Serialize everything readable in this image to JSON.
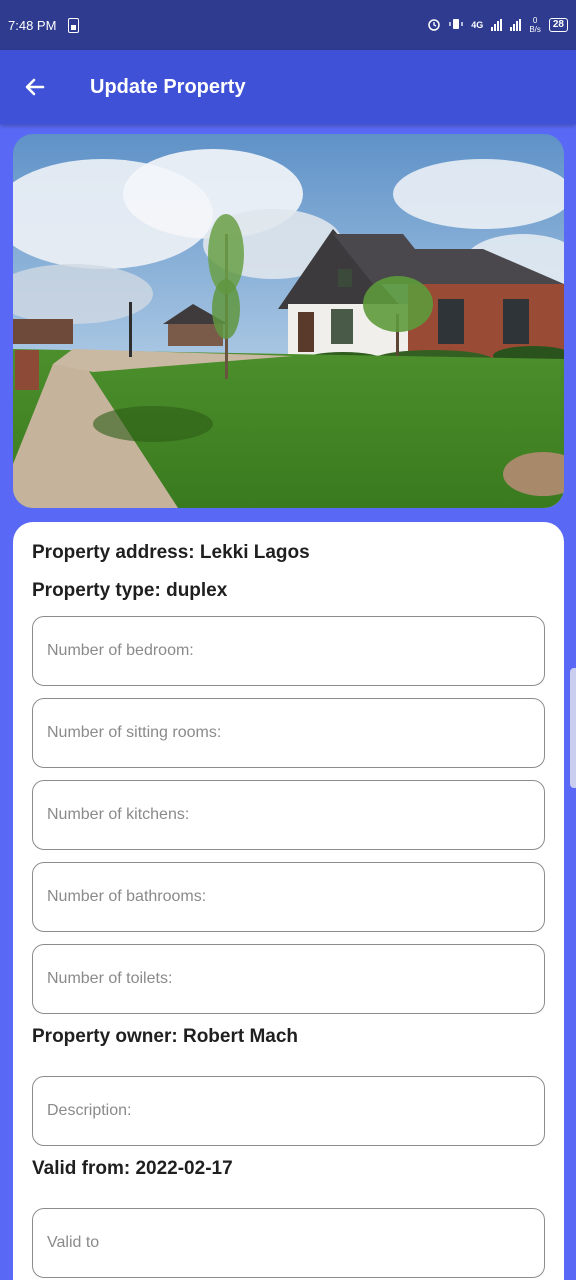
{
  "status_bar": {
    "time": "7:48 PM",
    "network": "4G",
    "speed_value": "0",
    "speed_unit": "B/s",
    "battery": "28"
  },
  "app_bar": {
    "title": "Update Property",
    "back_icon": "arrow-left-icon"
  },
  "property": {
    "address": "Property address: Lekki Lagos",
    "type": "Property type: duplex",
    "owner": "Property owner: Robert Mach",
    "valid_from": "Valid from: 2022-02-17"
  },
  "fields": {
    "bedroom_placeholder": "Number of bedroom:",
    "sitting_rooms_placeholder": "Number of sitting rooms:",
    "kitchens_placeholder": "Number of kitchens:",
    "bathrooms_placeholder": "Number of bathrooms:",
    "toilets_placeholder": "Number of toilets:",
    "description_placeholder": "Description:",
    "valid_to_placeholder": "Valid to"
  },
  "colors": {
    "background": "#5a69f5",
    "app_bar": "#3f51d6",
    "status_bar": "#2e3b8f"
  }
}
